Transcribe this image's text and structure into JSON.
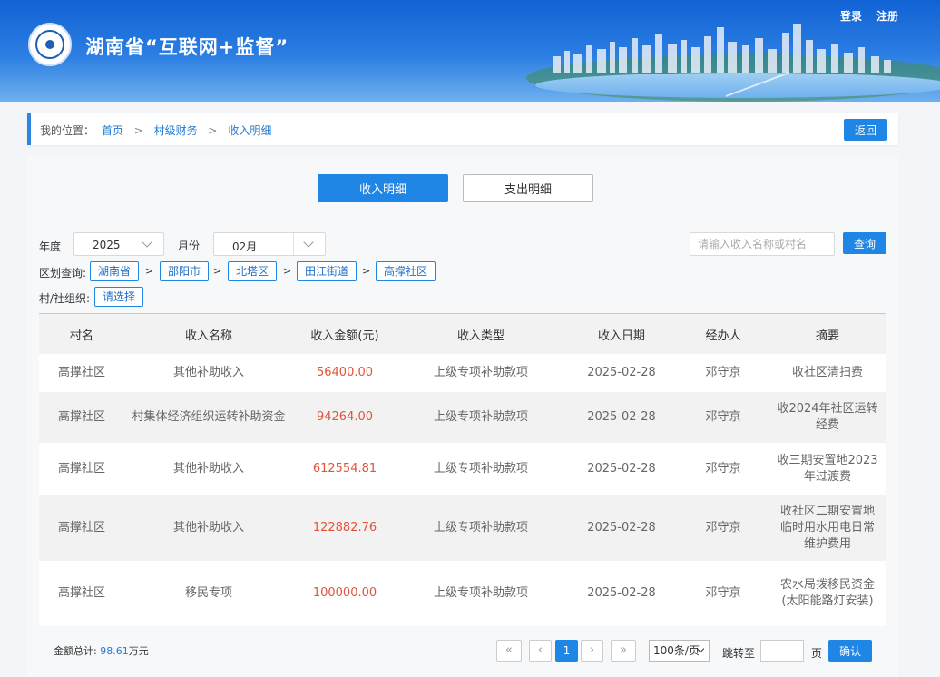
{
  "header": {
    "title": "湖南省“互联网+监督”",
    "login": "登录",
    "register": "注册",
    "logo_icon": "eye-seal-icon"
  },
  "breadcrumb": {
    "prefix": "我的位置：",
    "items": [
      "首页",
      "村级财务",
      "收入明细"
    ],
    "back_label": "返回"
  },
  "tabs": [
    {
      "label": "收入明细",
      "active": true
    },
    {
      "label": "支出明细",
      "active": false
    }
  ],
  "filters": {
    "year_label": "年度",
    "year_value": "2025",
    "month_label": "月份",
    "month_value": "02月",
    "search_placeholder": "请输入收入名称或村名",
    "query_label": "查询",
    "region_label": "区划查询:",
    "regions": [
      "湖南省",
      "邵阳市",
      "北塔区",
      "田江街道",
      "高撑社区"
    ],
    "org_label": "村/社组织:",
    "org_select": "请选择"
  },
  "table": {
    "columns": [
      "村名",
      "收入名称",
      "收入金额(元)",
      "收入类型",
      "收入日期",
      "经办人",
      "摘要"
    ],
    "rows": [
      [
        "高撑社区",
        "其他补助收入",
        "56400.00",
        "上级专项补助款项",
        "2025-02-28",
        "邓守京",
        "收社区清扫费"
      ],
      [
        "高撑社区",
        "村集体经济组织运转补助资金",
        "94264.00",
        "上级专项补助款项",
        "2025-02-28",
        "邓守京",
        "收2024年社区运转经费"
      ],
      [
        "高撑社区",
        "其他补助收入",
        "612554.81",
        "上级专项补助款项",
        "2025-02-28",
        "邓守京",
        "收三期安置地2023年过渡费"
      ],
      [
        "高撑社区",
        "其他补助收入",
        "122882.76",
        "上级专项补助款项",
        "2025-02-28",
        "邓守京",
        "收社区二期安置地临时用水用电日常维护费用"
      ],
      [
        "高撑社区",
        "移民专项",
        "100000.00",
        "上级专项补助款项",
        "2025-02-28",
        "邓守京",
        "农水局拨移民资金(太阳能路灯安装)"
      ]
    ]
  },
  "footer": {
    "total_label": "金额总计:",
    "total_value": "98.61",
    "total_unit": "万元",
    "first": "«",
    "prev": "‹",
    "current_page": "1",
    "next": "›",
    "last": "»",
    "page_size": "100条/页",
    "jump_label": "跳转至",
    "page_unit": "页",
    "confirm_label": "确认"
  },
  "colors": {
    "accent": "#1f86e6",
    "amount": "#e2533a",
    "header_top": "#1162d4"
  }
}
